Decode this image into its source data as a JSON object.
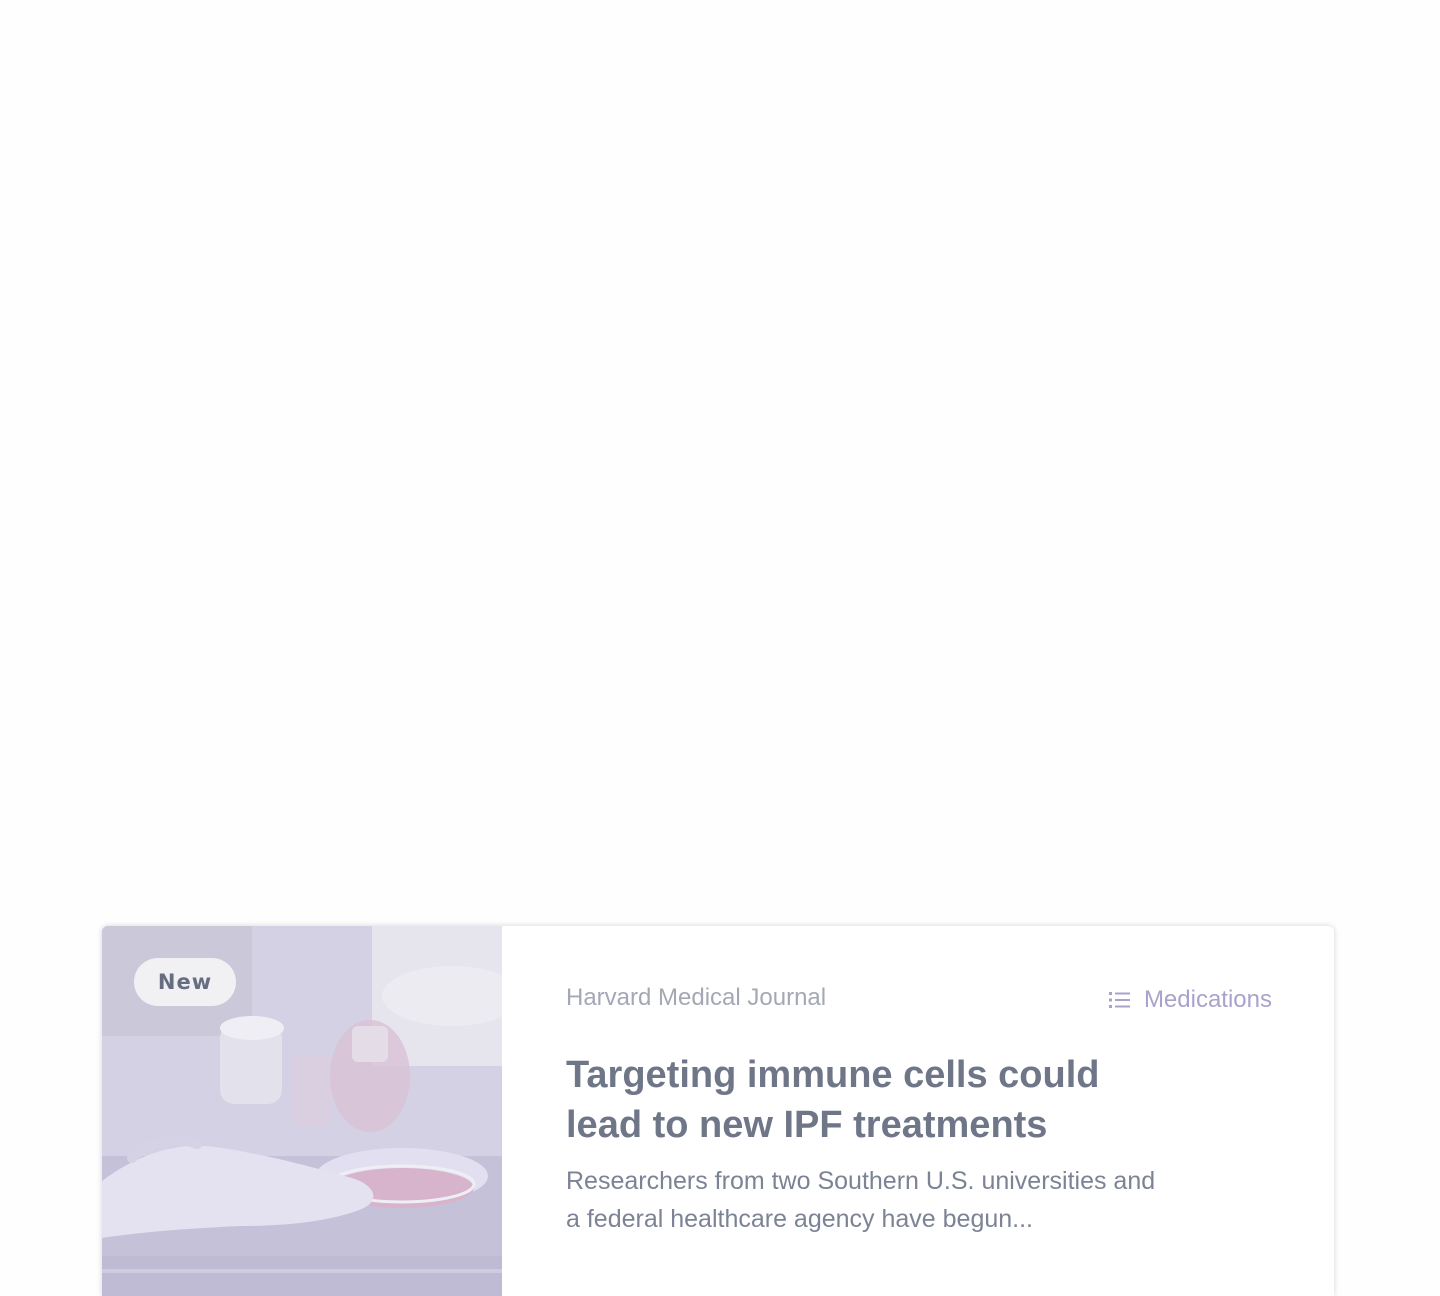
{
  "article_card": {
    "badge": "New",
    "source": "Harvard Medical Journal",
    "category": {
      "label": "Medications",
      "icon": "list-icon"
    },
    "title": "Targeting immune cells could lead to new IPF treatments",
    "excerpt": "Researchers from two Southern U.S. universities and a federal healthcare agency have begun...",
    "image": "lab-gloved-hand-petri-dish"
  },
  "colors": {
    "accent": "#a9a3cc",
    "title": "#6e7688",
    "muted": "#a4a8b6"
  }
}
